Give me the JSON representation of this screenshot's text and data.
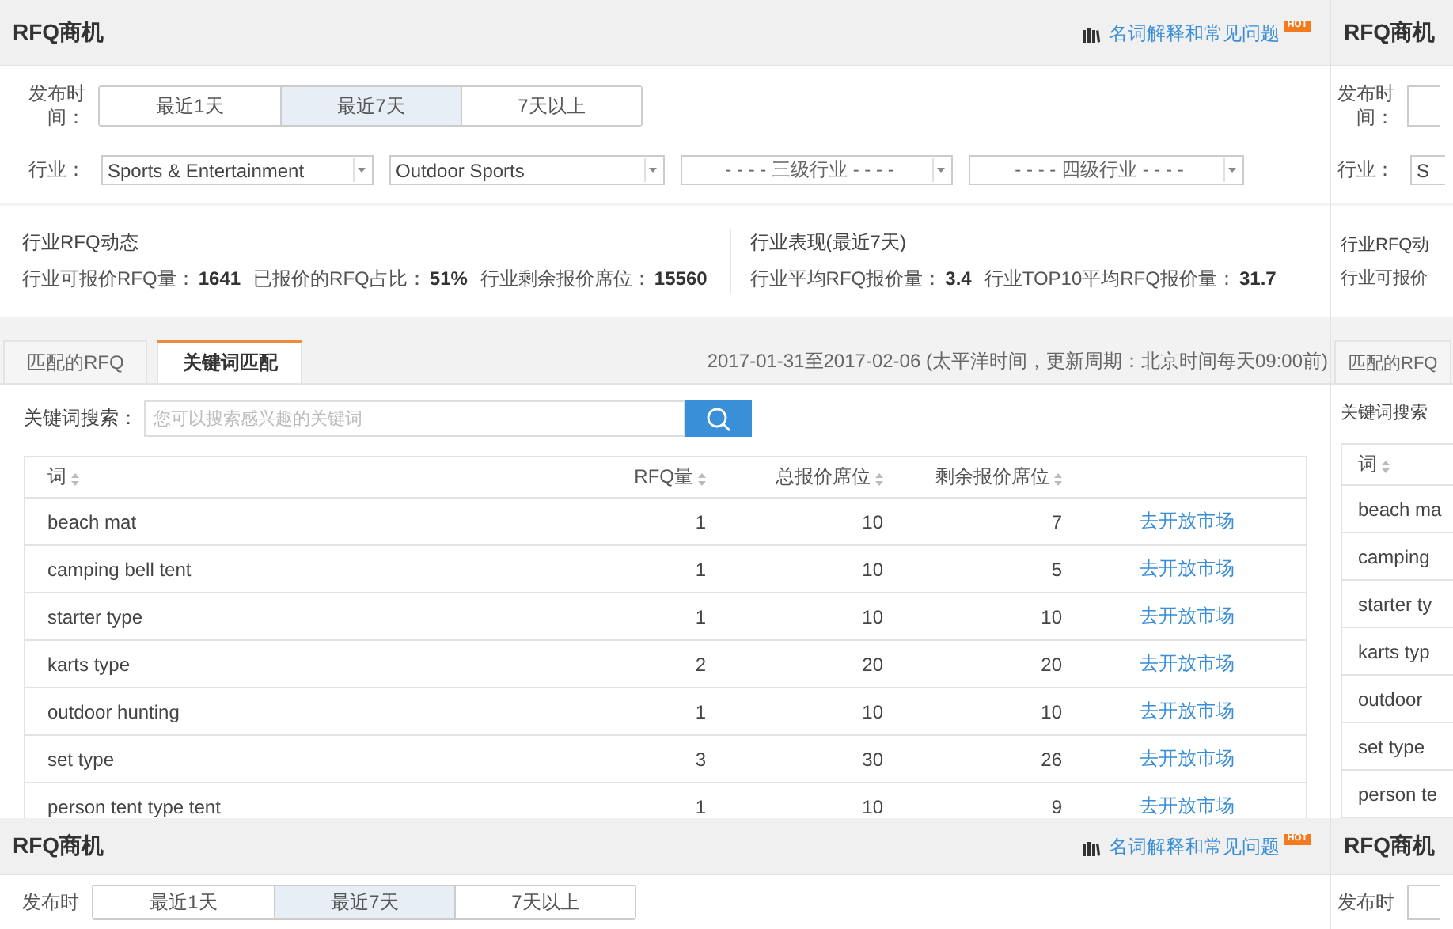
{
  "main": {
    "header": {
      "title": "RFQ商机",
      "help_link": "名词解释和常见问题",
      "hot_badge": "HOT"
    },
    "filters": {
      "time_label": "发布时间：",
      "time_options": [
        {
          "label": "最近1天",
          "selected": false
        },
        {
          "label": "最近7天",
          "selected": true
        },
        {
          "label": "7天以上",
          "selected": false
        }
      ],
      "industry_label": "行业：",
      "industry_selects": [
        {
          "value": "Sports & Entertainment"
        },
        {
          "value": "Outdoor Sports"
        },
        {
          "value": "- - - - 三级行业 - - - -"
        },
        {
          "value": "- - - - 四级行业 - - - -"
        }
      ]
    },
    "stats": [
      {
        "title": "行业RFQ动态",
        "items": [
          {
            "label": "行业可报价RFQ量：",
            "value": "1641"
          },
          {
            "label": "已报价的RFQ占比：",
            "value": "51%"
          },
          {
            "label": "行业剩余报价席位：",
            "value": "15560"
          }
        ]
      },
      {
        "title": "行业表现(最近7天)",
        "items": [
          {
            "label": "行业平均RFQ报价量：",
            "value": "3.4"
          },
          {
            "label": "行业TOP10平均RFQ报价量：",
            "value": "31.7"
          }
        ]
      }
    ],
    "tabs": [
      {
        "label": "匹配的RFQ",
        "selected": false
      },
      {
        "label": "关键词匹配",
        "selected": true
      }
    ],
    "date_note": "2017-01-31至2017-02-06 (太平洋时间，更新周期：北京时间每天09:00前)",
    "search": {
      "label": "关键词搜索：",
      "placeholder": "您可以搜索感兴趣的关键词"
    },
    "table": {
      "columns": [
        {
          "label": "词",
          "sortable": true
        },
        {
          "label": "RFQ量",
          "sortable": true
        },
        {
          "label": "总报价席位",
          "sortable": true
        },
        {
          "label": "剩余报价席位",
          "sortable": true
        }
      ],
      "rows": [
        {
          "word": "beach mat",
          "rfq": "1",
          "total": "10",
          "remaining": "7",
          "action": "去开放市场"
        },
        {
          "word": "camping bell tent",
          "rfq": "1",
          "total": "10",
          "remaining": "5",
          "action": "去开放市场"
        },
        {
          "word": "starter type",
          "rfq": "1",
          "total": "10",
          "remaining": "10",
          "action": "去开放市场"
        },
        {
          "word": "karts type",
          "rfq": "2",
          "total": "20",
          "remaining": "20",
          "action": "去开放市场"
        },
        {
          "word": "outdoor hunting",
          "rfq": "1",
          "total": "10",
          "remaining": "10",
          "action": "去开放市场"
        },
        {
          "word": "set type",
          "rfq": "3",
          "total": "30",
          "remaining": "26",
          "action": "去开放市场"
        },
        {
          "word": "person tent type tent",
          "rfq": "1",
          "total": "10",
          "remaining": "9",
          "action": "去开放市场"
        }
      ]
    }
  },
  "right_edge": {
    "title": "RFQ商机",
    "time_label": "发布时间：",
    "industry_label": "行业：",
    "industry_value": "S",
    "stats_title": "行业RFQ动",
    "stats_line": "行业可报价",
    "tab_label": "匹配的RFQ",
    "search_label": "关键词搜索",
    "column_label": "词",
    "rows": [
      "beach ma",
      "camping",
      "starter ty",
      "karts typ",
      "outdoor",
      "set type",
      "person te"
    ]
  },
  "bottom": {
    "header": {
      "title": "RFQ商机",
      "help_link": "名词解释和常见问题",
      "hot_badge": "HOT"
    },
    "time_label": "发布时",
    "time_options": [
      {
        "label": "最近1天",
        "selected": false
      },
      {
        "label": "最近7天",
        "selected": true
      },
      {
        "label": "7天以上",
        "selected": false
      }
    ],
    "right_title": "RFQ商机",
    "right_time_label": "发布时"
  }
}
